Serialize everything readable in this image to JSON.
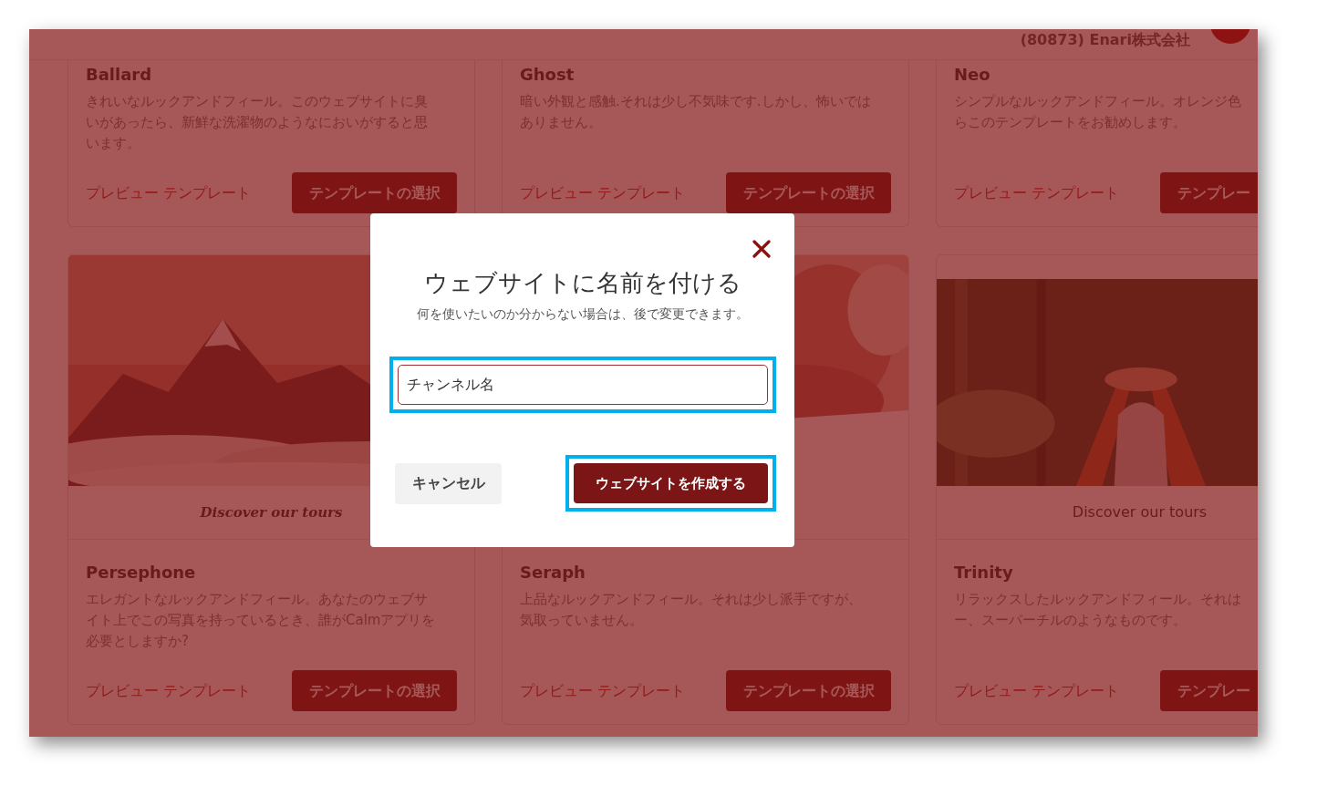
{
  "header": {
    "account": "(80873) Enari株式会社"
  },
  "templates": [
    {
      "name": "Ballard",
      "description_lines": [
        "きれいなルックアンドフィール。このウェブサイトに臭",
        "いがあったら、新鮮な洗濯物のようなにおいがすると思",
        "います。"
      ],
      "preview_link": "プレビュー テンプレート",
      "select_button": "テンプレートの選択"
    },
    {
      "name": "Ghost",
      "description_lines": [
        "暗い外観と感触.それは少し不気味です.しかし、怖いでは",
        "ありません。"
      ],
      "preview_link": "プレビュー テンプレート",
      "select_button": "テンプレートの選択"
    },
    {
      "name": "Neo",
      "description_lines": [
        "シンプルなルックアンドフィール。オレンジ色",
        "らこのテンプレートをお勧めします。"
      ],
      "preview_link": "プレビュー テンプレート",
      "select_button": "テンプレー"
    },
    {
      "name": "Persephone",
      "thumbnail": {
        "kind": "mountain",
        "caption": "Discover our tours"
      },
      "description_lines": [
        "エレガントなルックアンドフィール。あなたのウェブサ",
        "イト上でこの写真を持っているとき、誰がCalmアプリを",
        "必要としますか?"
      ],
      "preview_link": "プレビュー テンプレート",
      "select_button": "テンプレートの選択"
    },
    {
      "name": "Seraph",
      "thumbnail": {
        "kind": "portrait"
      },
      "description_lines": [
        "上品なルックアンドフィール。それは少し派手ですが、",
        "気取っていません。"
      ],
      "preview_link": "プレビュー テンプレート",
      "select_button": "テンプレートの選択"
    },
    {
      "name": "Trinity",
      "thumbnail": {
        "kind": "forest",
        "caption": "Discover our tours"
      },
      "description_lines": [
        "リラックスしたルックアンドフィール。それは",
        "ー、スーパーチルのようなものです。"
      ],
      "preview_link": "プレビュー テンプレート",
      "select_button": "テンプレー"
    }
  ],
  "dialog": {
    "title": "ウェブサイトに名前を付ける",
    "subtitle": "何を使いたいのか分からない場合は、後で変更できます。",
    "input": {
      "value": "チャンネル名",
      "highlighted": true
    },
    "cancel_button": "キャンセル",
    "create_button": {
      "label": "ウェブサイトを作成する",
      "highlighted": true
    }
  }
}
